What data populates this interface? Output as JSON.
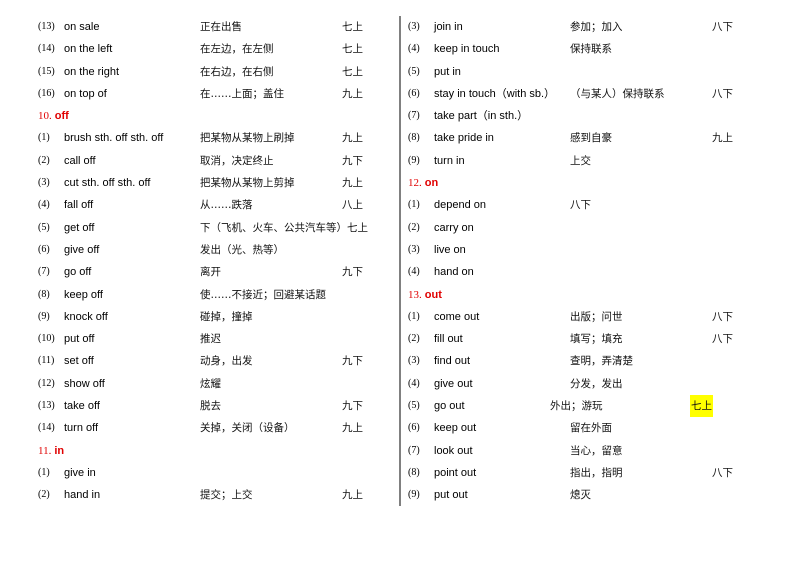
{
  "left_column": [
    {
      "type": "entry",
      "num": "(13)",
      "en": "on sale",
      "zh": "正在出售",
      "grade": "七上"
    },
    {
      "type": "entry",
      "num": "(14)",
      "en": "on the left",
      "zh": "在左边，在左侧",
      "grade": "七上"
    },
    {
      "type": "entry",
      "num": "(15)",
      "en": "on the right",
      "zh": "在右边，在右侧",
      "grade": "七上"
    },
    {
      "type": "entry",
      "num": "(16)",
      "en": "on top of",
      "zh": "在……上面；盖住",
      "grade": "九上"
    },
    {
      "type": "section",
      "num": "10.",
      "word": "off"
    },
    {
      "type": "entry",
      "num": "(1)",
      "en": "brush sth. off sth. off",
      "zh": "把某物从某物上刷掉",
      "grade": "九上"
    },
    {
      "type": "entry",
      "num": "(2)",
      "en": "call off",
      "zh": "取消，决定终止",
      "grade": "九下"
    },
    {
      "type": "entry",
      "num": "(3)",
      "en": "cut sth. off sth. off",
      "zh": "把某物从某物上剪掉",
      "grade": "九上"
    },
    {
      "type": "entry",
      "num": "(4)",
      "en": "fall off",
      "zh": "从……跌落",
      "grade": "八上"
    },
    {
      "type": "entry",
      "num": "(5)",
      "en": "get off",
      "zh": "下（飞机、火车、公共汽车等）七上",
      "grade": ""
    },
    {
      "type": "entry",
      "num": "(6)",
      "en": "give off",
      "zh": "发出（光、热等）",
      "grade": ""
    },
    {
      "type": "entry",
      "num": "(7)",
      "en": "go off",
      "zh": "离开",
      "grade": "九下"
    },
    {
      "type": "entry",
      "num": "(8)",
      "en": "keep off",
      "zh": "使……不接近；回避某话题",
      "grade": ""
    },
    {
      "type": "entry",
      "num": "(9)",
      "en": "knock off",
      "zh": "碰掉，撞掉",
      "grade": ""
    },
    {
      "type": "entry",
      "num": "(10)",
      "en": "put off",
      "zh": "推迟",
      "grade": ""
    },
    {
      "type": "entry",
      "num": "(11)",
      "en": "set off",
      "zh": "动身，出发",
      "grade": "九下"
    },
    {
      "type": "entry",
      "num": "(12)",
      "en": "show off",
      "zh": "炫耀",
      "grade": ""
    },
    {
      "type": "entry",
      "num": "(13)",
      "en": "take off",
      "zh": "脱去",
      "grade": "九下"
    },
    {
      "type": "entry",
      "num": "(14)",
      "en": "turn off",
      "zh": "关掉，关闭（设备）",
      "grade": "九上"
    },
    {
      "type": "section",
      "num": "11.",
      "word": "in"
    },
    {
      "type": "entry",
      "num": "(1)",
      "en": "give in",
      "zh": "",
      "grade": ""
    },
    {
      "type": "entry",
      "num": "(2)",
      "en": "hand in",
      "zh": "提交；上交",
      "grade": "九上"
    }
  ],
  "right_column": [
    {
      "type": "entry",
      "num": "(3)",
      "en": "join in",
      "zh": "参加；加入",
      "grade": "八下"
    },
    {
      "type": "entry",
      "num": "(4)",
      "en": "keep in touch",
      "zh": "保持联系",
      "grade": ""
    },
    {
      "type": "entry",
      "num": "(5)",
      "en": "put in",
      "zh": "",
      "grade": ""
    },
    {
      "type": "entry",
      "num": "(6)",
      "en": "stay in touch（with sb.）",
      "zh": "（与某人）保持联系",
      "grade": "八下"
    },
    {
      "type": "entry",
      "num": "(7)",
      "en": "take part（in sth.）",
      "zh": "",
      "grade": ""
    },
    {
      "type": "entry",
      "num": "(8)",
      "en": "take pride in",
      "zh": "感到自豪",
      "grade": "九上"
    },
    {
      "type": "entry",
      "num": "(9)",
      "en": "turn in",
      "zh": "上交",
      "grade": ""
    },
    {
      "type": "section",
      "num": "12.",
      "word": "on"
    },
    {
      "type": "entry",
      "num": "(1)",
      "en": "depend on",
      "zh": "八下",
      "grade": ""
    },
    {
      "type": "entry",
      "num": "(2)",
      "en": "carry on",
      "zh": "",
      "grade": ""
    },
    {
      "type": "entry",
      "num": "(3)",
      "en": "live on",
      "zh": "",
      "grade": ""
    },
    {
      "type": "entry",
      "num": "(4)",
      "en": "hand on",
      "zh": "",
      "grade": ""
    },
    {
      "type": "section",
      "num": "13.",
      "word": "out"
    },
    {
      "type": "entry",
      "num": "(1)",
      "en": "come out",
      "zh": "出版；问世",
      "grade": "八下"
    },
    {
      "type": "entry",
      "num": "(2)",
      "en": "fill out",
      "zh": "填写；填充",
      "grade": "八下"
    },
    {
      "type": "entry",
      "num": "(3)",
      "en": "find out",
      "zh": "查明，弄清楚",
      "grade": ""
    },
    {
      "type": "entry",
      "num": "(4)",
      "en": "give out",
      "zh": "分发，发出",
      "grade": ""
    },
    {
      "type": "entry",
      "num": "(5)",
      "en": "go out",
      "zh": "外出；游玩",
      "grade": "七上",
      "shifted": true,
      "highlight": true
    },
    {
      "type": "entry",
      "num": "(6)",
      "en": "keep out",
      "zh": "留在外面",
      "grade": ""
    },
    {
      "type": "entry",
      "num": "(7)",
      "en": "look out",
      "zh": "当心，留意",
      "grade": ""
    },
    {
      "type": "entry",
      "num": "(8)",
      "en": "point out",
      "zh": "指出，指明",
      "grade": "八下"
    },
    {
      "type": "entry",
      "num": "(9)",
      "en": "put out",
      "zh": "熄灭",
      "grade": ""
    }
  ],
  "colors": {
    "section_heading": "#e00000",
    "highlight": "#ffff00",
    "divider": "#808080"
  }
}
